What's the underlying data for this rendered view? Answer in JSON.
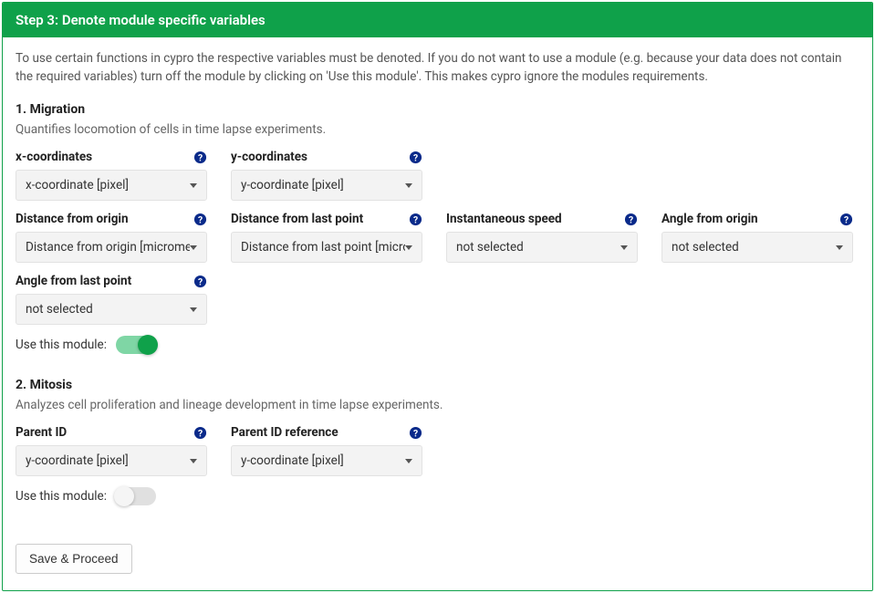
{
  "header": {
    "title": "Step 3: Denote module specific variables"
  },
  "intro": "To use certain functions in cypro the respective variables must be denoted. If you do not want to use a module (e.g. because your data does not contain the required variables) turn off the module by clicking on 'Use this module'. This makes cypro ignore the modules requirements.",
  "module1": {
    "title": "1. Migration",
    "desc": "Quantifies locomotion of cells in time lapse experiments.",
    "fields": {
      "xcoord": {
        "label": "x-coordinates",
        "value": "x-coordinate [pixel]"
      },
      "ycoord": {
        "label": "y-coordinates",
        "value": "y-coordinate [pixel]"
      },
      "dist_origin": {
        "label": "Distance from origin",
        "value": "Distance from origin [micrometer]"
      },
      "dist_last": {
        "label": "Distance from last point",
        "value": "Distance from last point [micrometer]"
      },
      "inst_speed": {
        "label": "Instantaneous speed",
        "value": "not selected"
      },
      "angle_origin": {
        "label": "Angle from origin",
        "value": "not selected"
      },
      "angle_last": {
        "label": "Angle from last point",
        "value": "not selected"
      }
    },
    "use_label": "Use this module:",
    "use_enabled": true
  },
  "module2": {
    "title": "2. Mitosis",
    "desc": "Analyzes cell proliferation and lineage development in time lapse experiments.",
    "fields": {
      "parent_id": {
        "label": "Parent ID",
        "value": "y-coordinate [pixel]"
      },
      "parent_id_ref": {
        "label": "Parent ID reference",
        "value": "y-coordinate [pixel]"
      }
    },
    "use_label": "Use this module:",
    "use_enabled": false
  },
  "save_label": "Save & Proceed"
}
